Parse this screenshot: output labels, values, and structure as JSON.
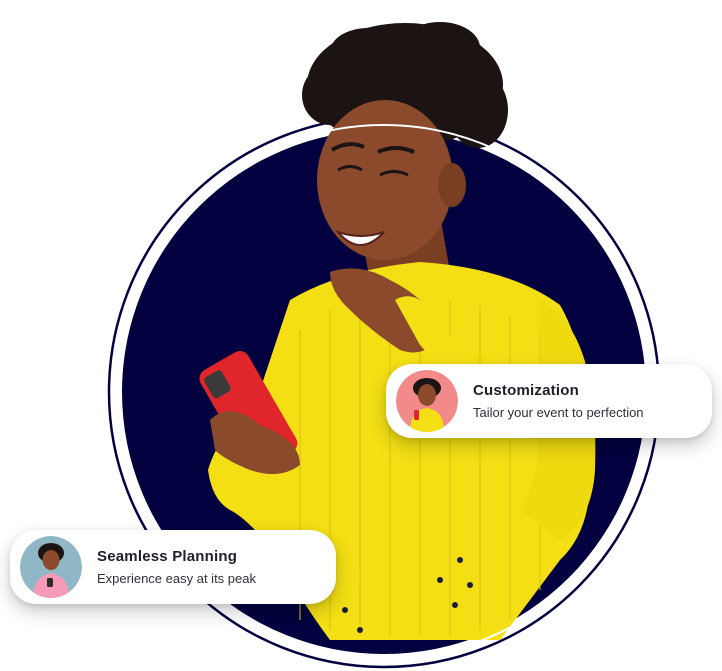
{
  "cards": [
    {
      "title": "Customization",
      "subtitle": "Tailor your event to perfection",
      "avatar_icon": "woman-yellow-sweater-avatar",
      "avatar_bg": "#f28a8a"
    },
    {
      "title": "Seamless Planning",
      "subtitle": "Experience easy at its peak",
      "avatar_icon": "woman-pink-sweater-avatar",
      "avatar_bg": "#8fb7c6"
    }
  ],
  "colors": {
    "circle": "#03003f",
    "ring": "#03003f",
    "sweater": "#f3df14",
    "phone": "#e0262a",
    "skin": "#8a4a2b"
  }
}
